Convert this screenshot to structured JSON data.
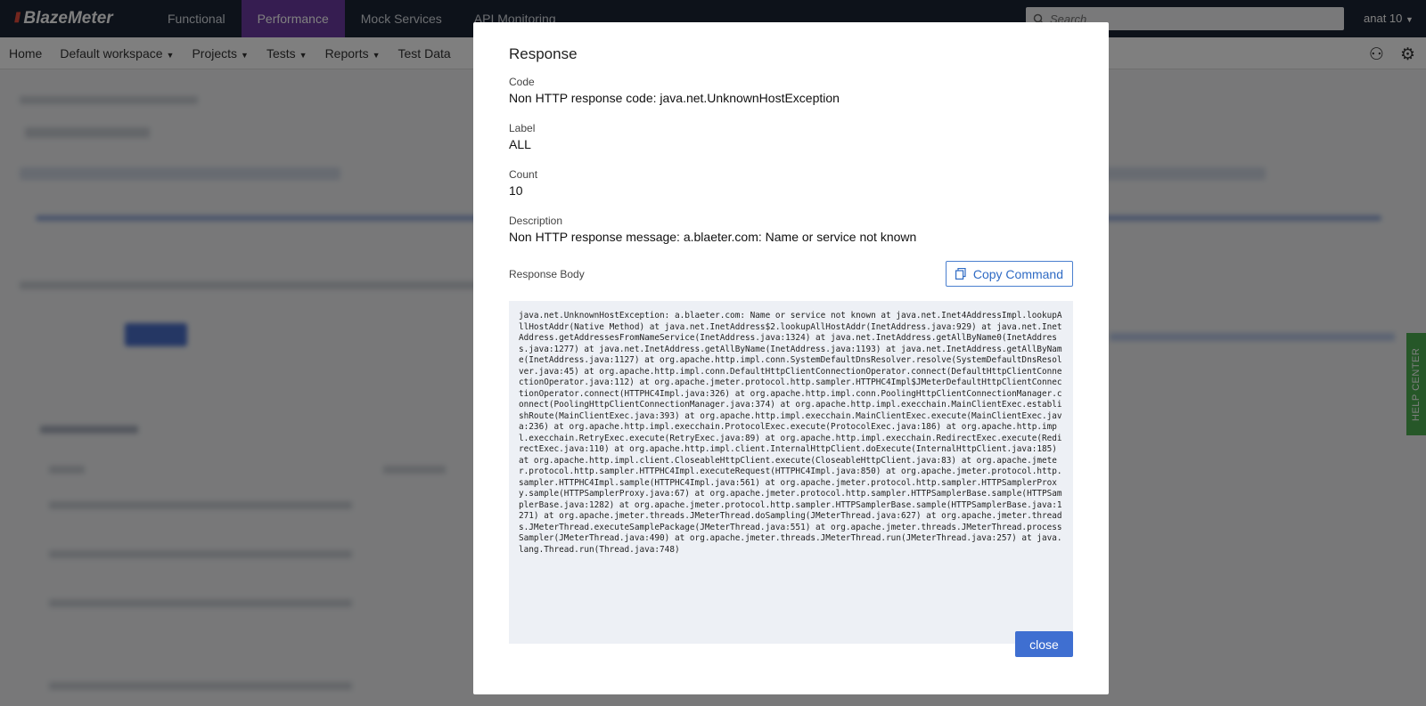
{
  "app": {
    "logo": "BlazeMeter",
    "user": "anat 10"
  },
  "topnav": [
    "Functional",
    "Performance",
    "Mock Services",
    "API Monitoring"
  ],
  "search": {
    "placeholder": "Search"
  },
  "subnav": [
    "Home",
    "Default workspace",
    "Projects",
    "Tests",
    "Reports",
    "Test Data"
  ],
  "help_center": "HELP CENTER",
  "modal": {
    "title": "Response",
    "code_label": "Code",
    "code_value": "Non HTTP response code: java.net.UnknownHostException",
    "label_label": "Label",
    "label_value": "ALL",
    "count_label": "Count",
    "count_value": "10",
    "description_label": "Description",
    "description_value": "Non HTTP response message: a.blaeter.com: Name or service not known",
    "response_body_label": "Response Body",
    "copy_button": "Copy Command",
    "response_body": "java.net.UnknownHostException: a.blaeter.com: Name or service not known at java.net.Inet4AddressImpl.lookupAllHostAddr(Native Method) at java.net.InetAddress$2.lookupAllHostAddr(InetAddress.java:929) at java.net.InetAddress.getAddressesFromNameService(InetAddress.java:1324) at java.net.InetAddress.getAllByName0(InetAddress.java:1277) at java.net.InetAddress.getAllByName(InetAddress.java:1193) at java.net.InetAddress.getAllByName(InetAddress.java:1127) at org.apache.http.impl.conn.SystemDefaultDnsResolver.resolve(SystemDefaultDnsResolver.java:45) at org.apache.http.impl.conn.DefaultHttpClientConnectionOperator.connect(DefaultHttpClientConnectionOperator.java:112) at org.apache.jmeter.protocol.http.sampler.HTTPHC4Impl$JMeterDefaultHttpClientConnectionOperator.connect(HTTPHC4Impl.java:326) at org.apache.http.impl.conn.PoolingHttpClientConnectionManager.connect(PoolingHttpClientConnectionManager.java:374) at org.apache.http.impl.execchain.MainClientExec.establishRoute(MainClientExec.java:393) at org.apache.http.impl.execchain.MainClientExec.execute(MainClientExec.java:236) at org.apache.http.impl.execchain.ProtocolExec.execute(ProtocolExec.java:186) at org.apache.http.impl.execchain.RetryExec.execute(RetryExec.java:89) at org.apache.http.impl.execchain.RedirectExec.execute(RedirectExec.java:110) at org.apache.http.impl.client.InternalHttpClient.doExecute(InternalHttpClient.java:185) at org.apache.http.impl.client.CloseableHttpClient.execute(CloseableHttpClient.java:83) at org.apache.jmeter.protocol.http.sampler.HTTPHC4Impl.executeRequest(HTTPHC4Impl.java:850) at org.apache.jmeter.protocol.http.sampler.HTTPHC4Impl.sample(HTTPHC4Impl.java:561) at org.apache.jmeter.protocol.http.sampler.HTTPSamplerProxy.sample(HTTPSamplerProxy.java:67) at org.apache.jmeter.protocol.http.sampler.HTTPSamplerBase.sample(HTTPSamplerBase.java:1282) at org.apache.jmeter.protocol.http.sampler.HTTPSamplerBase.sample(HTTPSamplerBase.java:1271) at org.apache.jmeter.threads.JMeterThread.doSampling(JMeterThread.java:627) at org.apache.jmeter.threads.JMeterThread.executeSamplePackage(JMeterThread.java:551) at org.apache.jmeter.threads.JMeterThread.processSampler(JMeterThread.java:490) at org.apache.jmeter.threads.JMeterThread.run(JMeterThread.java:257) at java.lang.Thread.run(Thread.java:748)",
    "close_button": "close"
  }
}
